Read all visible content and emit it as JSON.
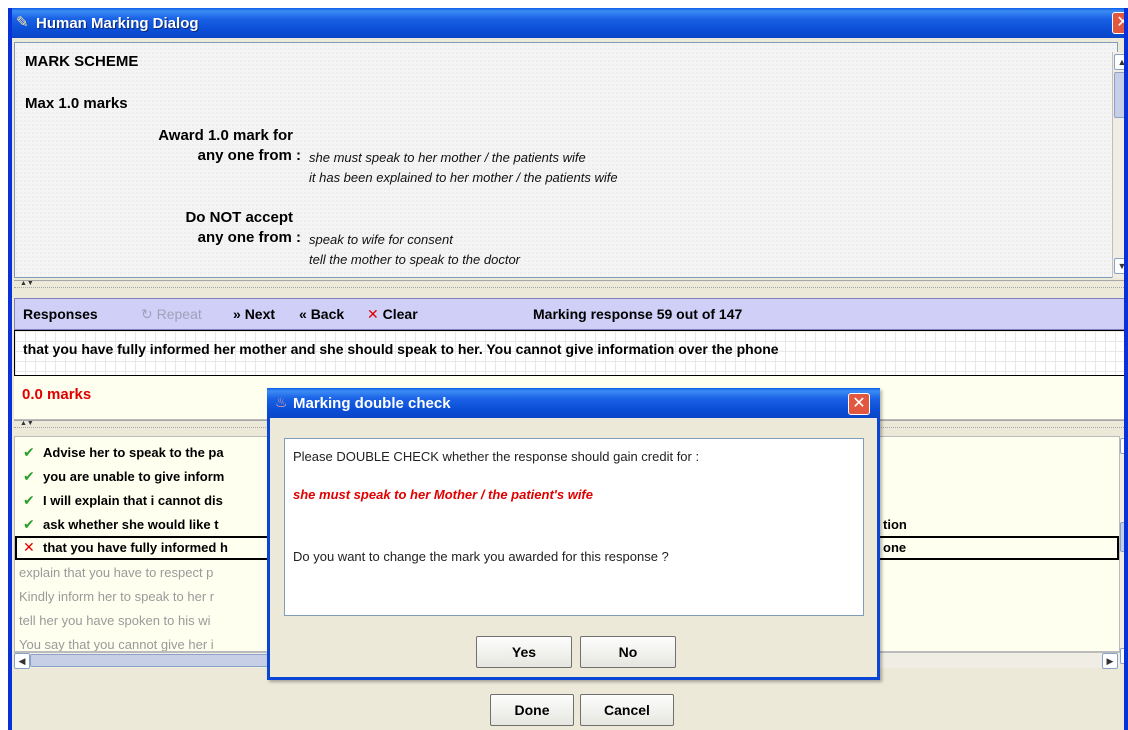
{
  "window": {
    "title": "Human Marking Dialog"
  },
  "mark_scheme": {
    "heading": "MARK SCHEME",
    "max_marks": "Max 1.0 marks",
    "award_label": "Award 1.0 mark for",
    "award_any": "any one from :",
    "award_items": [
      "she must speak to her mother / the patients wife",
      "it has been explained to her mother / the patients wife"
    ],
    "reject_label": "Do NOT accept",
    "reject_any": "any one from :",
    "reject_items": [
      "speak to wife for consent",
      "tell the mother to speak to the doctor"
    ]
  },
  "toolbar": {
    "responses_label": "Responses",
    "repeat_label": "Repeat",
    "next_label": "Next",
    "back_label": "Back",
    "clear_label": "Clear",
    "status": "Marking response 59 out of 147"
  },
  "current_response": {
    "text": "that you have fully informed her mother and she should speak to her.  You cannot give information over the phone",
    "marks": "0.0 marks"
  },
  "response_list": {
    "marked": [
      {
        "status": "correct",
        "text": "Advise her to speak to the pa"
      },
      {
        "status": "correct",
        "text": "you are unable to give inform"
      },
      {
        "status": "correct",
        "text": "I will explain that i cannot dis"
      },
      {
        "status": "correct",
        "text": "ask whether she would like t",
        "tail": "tion"
      },
      {
        "status": "incorrect",
        "text": "that you have fully informed h",
        "tail": "one"
      }
    ],
    "unmarked": [
      "explain that you have to respect p",
      "Kindly inform her to speak to her r",
      "tell her you have spoken to his wi",
      "You say that you cannot give her i"
    ]
  },
  "footer": {
    "done_label": "Done",
    "cancel_label": "Cancel"
  },
  "dialog": {
    "title": "Marking double check",
    "prompt": "Please DOUBLE CHECK whether the response should gain credit for :",
    "credit_text": "she must speak to her Mother / the patient's wife",
    "question": "Do you want to change the mark you awarded for this response ?",
    "yes_label": "Yes",
    "no_label": "No"
  }
}
